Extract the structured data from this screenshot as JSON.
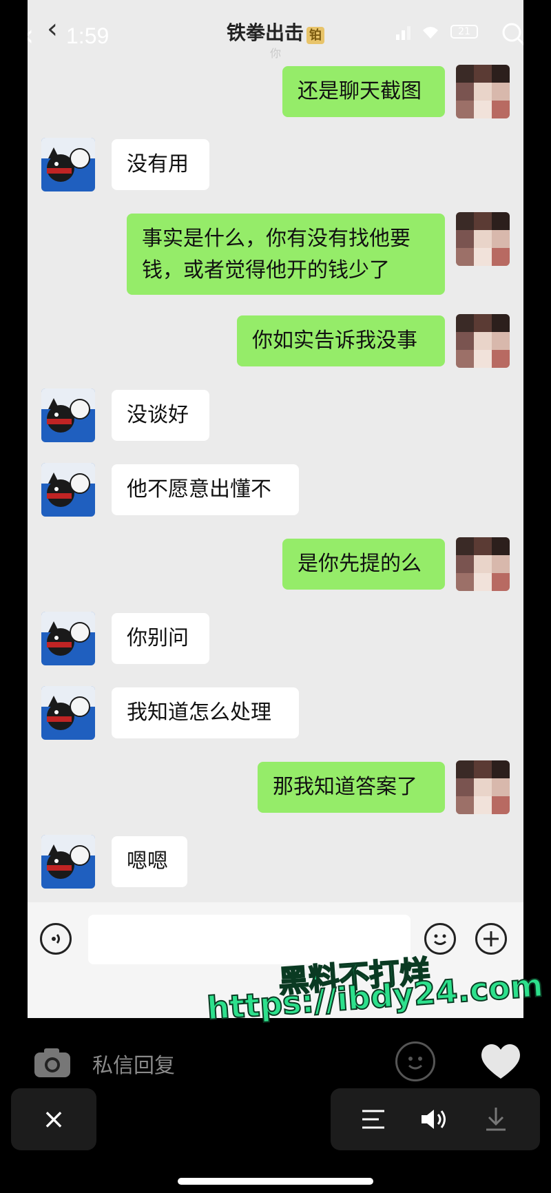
{
  "status_bar": {
    "time": "1:59",
    "battery": "21"
  },
  "header": {
    "title": "铁拳出击",
    "title_badge": "铂",
    "subtitle": "你"
  },
  "messages": [
    {
      "side": "right",
      "text": "还是聊天截图"
    },
    {
      "side": "left",
      "text": "没有用"
    },
    {
      "side": "right",
      "text": "事实是什么，你有没有找他要\n钱，或者觉得他开的钱少了"
    },
    {
      "side": "right",
      "text": "你如实告诉我没事"
    },
    {
      "side": "left",
      "text": "没谈好"
    },
    {
      "side": "left",
      "text": "他不愿意出懂不"
    },
    {
      "side": "right",
      "text": "是你先提的么"
    },
    {
      "side": "left",
      "text": "你别问"
    },
    {
      "side": "left",
      "text": "我知道怎么处理"
    },
    {
      "side": "right",
      "text": "那我知道答案了"
    },
    {
      "side": "left",
      "text": "嗯嗯"
    }
  ],
  "reply": {
    "placeholder": "私信回复"
  },
  "bottom": {
    "close_label": "×"
  },
  "watermark": {
    "line1": "黑料不打烊",
    "line2": "https://ibdy24.com"
  },
  "colors": {
    "bubble_right": "#95ec69",
    "bubble_left": "#ffffff",
    "watermark": "#2de08c"
  },
  "icons": [
    "back-icon",
    "search-icon",
    "voice-icon",
    "emoji-icon",
    "plus-icon",
    "camera-icon",
    "heart-icon",
    "close-icon",
    "menu-icon",
    "speaker-icon",
    "download-icon"
  ]
}
